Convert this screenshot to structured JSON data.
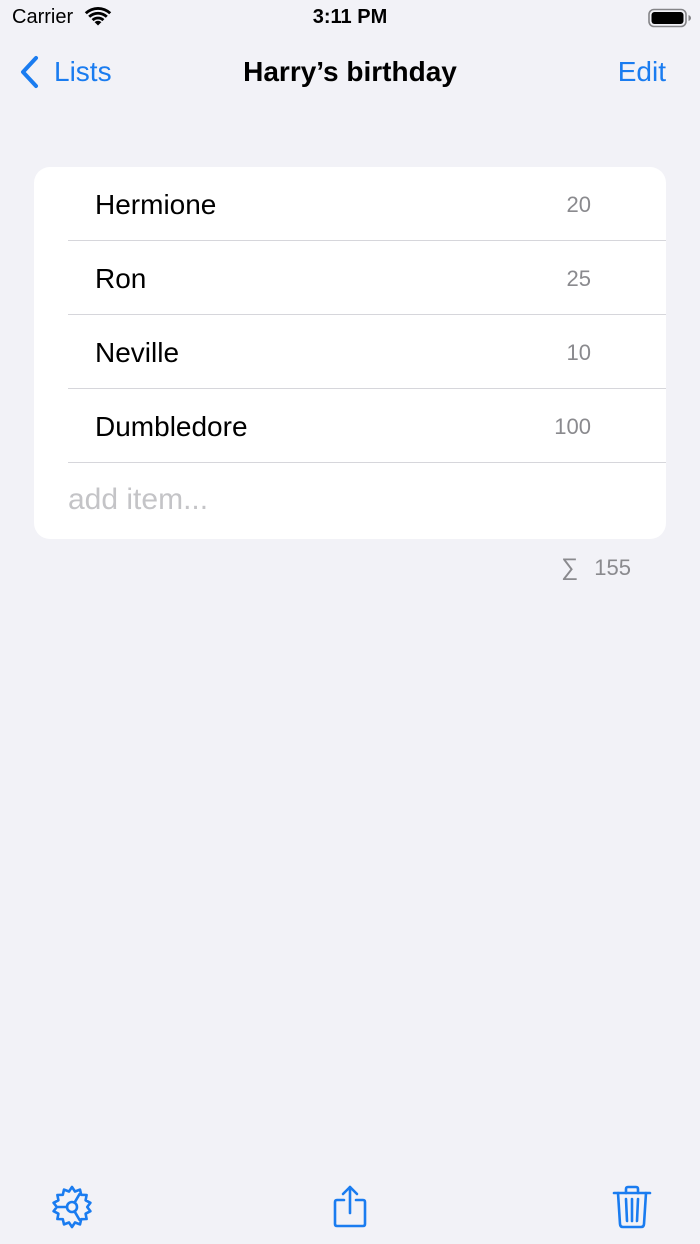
{
  "status_bar": {
    "carrier": "Carrier",
    "time": "3:11 PM",
    "icons": [
      "wifi-icon",
      "battery-icon"
    ]
  },
  "nav": {
    "back_label": "Lists",
    "back_icon": "chevron-left-icon",
    "title": "Harry’s birthday",
    "edit_label": "Edit"
  },
  "list": {
    "items": [
      {
        "name": "Hermione",
        "value": "20"
      },
      {
        "name": "Ron",
        "value": "25"
      },
      {
        "name": "Neville",
        "value": "10"
      },
      {
        "name": "Dumbledore",
        "value": "100"
      }
    ],
    "add_placeholder": "add item..."
  },
  "summary": {
    "symbol": "∑",
    "total": "155"
  },
  "toolbar": {
    "icons": [
      "gear-icon",
      "share-icon",
      "trash-icon"
    ]
  },
  "colors": {
    "accent": "#1A7CF0",
    "background": "#F2F2F7",
    "card": "#FFFFFF",
    "secondary_text": "#8A8A8E",
    "separator": "#D6D6DB"
  }
}
